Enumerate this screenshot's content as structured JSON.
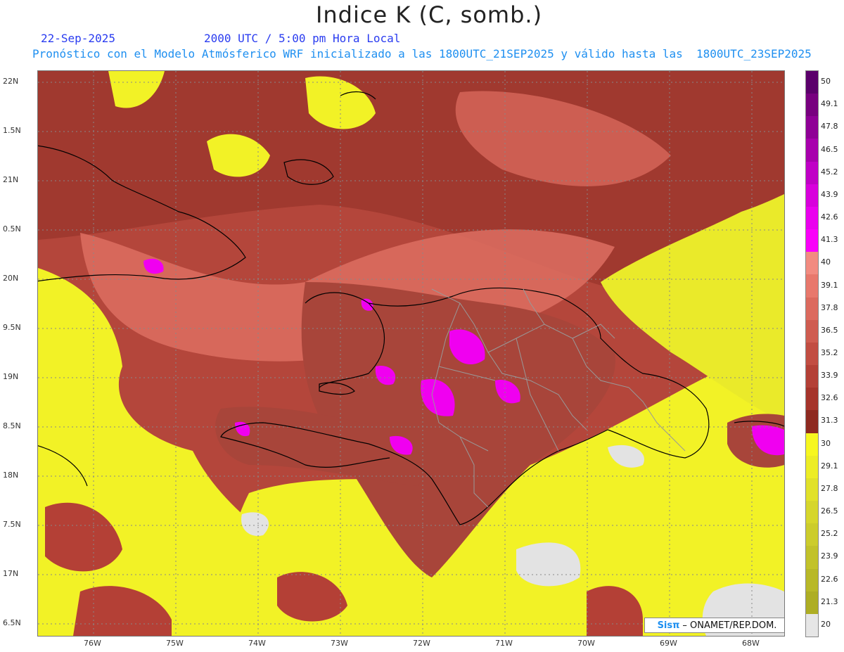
{
  "header": {
    "title": "Indice K (C, somb.)",
    "date": "22-Sep-2025",
    "time": "2000 UTC / 5:00 pm Hora Local",
    "model_line": "Pronóstico con el Modelo Atmósferico WRF inicializado a las 1800UTC_21SEP2025 y válido hasta las  1800UTC_23SEP2025"
  },
  "axes": {
    "lat_labels": [
      "22N",
      "1.5N",
      "21N",
      "0.5N",
      "20N",
      "9.5N",
      "19N",
      "8.5N",
      "18N",
      "7.5N",
      "17N",
      "6.5N"
    ],
    "lon_labels": [
      "76W",
      "75W",
      "74W",
      "73W",
      "72W",
      "71W",
      "70W",
      "69W",
      "68W"
    ]
  },
  "colorbar": {
    "labels": [
      "50",
      "49.1",
      "47.8",
      "46.5",
      "45.2",
      "43.9",
      "42.6",
      "41.3",
      "40",
      "39.1",
      "37.8",
      "36.5",
      "35.2",
      "33.9",
      "32.6",
      "31.3",
      "30",
      "29.1",
      "27.8",
      "26.5",
      "25.2",
      "23.9",
      "22.6",
      "21.3",
      "20"
    ],
    "colors": [
      "#5b006b",
      "#78007f",
      "#8f0096",
      "#a800ad",
      "#c000c6",
      "#d800dc",
      "#ea00ee",
      "#fa00fa",
      "#f28b80",
      "#e8786c",
      "#dc6a5e",
      "#cf5c50",
      "#c24d42",
      "#b44036",
      "#a6342b",
      "#8e2a20",
      "#f7f71f",
      "#eded25",
      "#e1e12a",
      "#d6d62c",
      "#cccc2c",
      "#c2c22a",
      "#b8b828",
      "#aeae24",
      "#e6e6e6"
    ]
  },
  "credit": {
    "brand": "Sisπ",
    "text": "– ONAMET/REP.DOM."
  },
  "colors": {
    "sea_yellow": "#f2f226",
    "dry_gray": "#e3e3e3",
    "moist_dark": "#8f2f25",
    "moist_mid": "#c24d42",
    "moist_light": "#e57a6d",
    "convective_magenta": "#f000f0",
    "coastline": "#000000",
    "boundaries": "#999999"
  }
}
